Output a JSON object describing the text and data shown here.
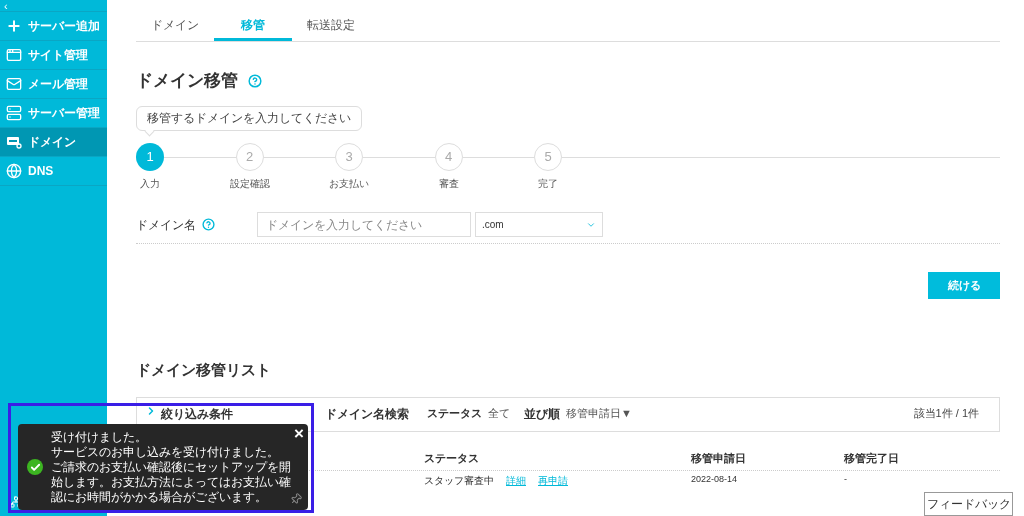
{
  "sidebar": {
    "collapse_label": "‹",
    "items": [
      {
        "kind": "plus",
        "label": "サーバー追加",
        "selected": false
      },
      {
        "kind": "window",
        "label": "サイト管理",
        "selected": false
      },
      {
        "kind": "mail",
        "label": "メール管理",
        "selected": false
      },
      {
        "kind": "server",
        "label": "サーバー管理",
        "selected": false
      },
      {
        "kind": "domain",
        "label": "ドメイン",
        "selected": true
      },
      {
        "kind": "globe",
        "label": "DNS",
        "selected": false
      }
    ]
  },
  "tabs": [
    {
      "label": "ドメイン",
      "selected": false
    },
    {
      "label": "移管",
      "selected": true
    },
    {
      "label": "転送設定",
      "selected": false
    }
  ],
  "title": "ドメイン移管",
  "hint": "移管するドメインを入力してください",
  "steps": [
    {
      "number": "1",
      "label": "入力",
      "selected": true
    },
    {
      "number": "2",
      "label": "設定確認",
      "selected": false
    },
    {
      "number": "3",
      "label": "お支払い",
      "selected": false
    },
    {
      "number": "4",
      "label": "審査",
      "selected": false
    },
    {
      "number": "5",
      "label": "完了",
      "selected": false
    }
  ],
  "form": {
    "label": "ドメイン名",
    "placeholder": "ドメインを入力してください",
    "tld": ".com",
    "submit": "続ける"
  },
  "list": {
    "title": "ドメイン移管リスト",
    "filter": {
      "title": "絞り込み条件",
      "search": "ドメイン名検索",
      "status_label": "ステータス",
      "status_value": "全て",
      "sort_label": "並び順",
      "sort_value": "移管申請日▼",
      "count": "該当1件 / 1件"
    },
    "columns": [
      "ステータス",
      "移管申請日",
      "移管完了日"
    ],
    "rows": [
      {
        "status": "スタッフ審査中",
        "links": [
          "詳細",
          "再申請"
        ],
        "requested": "2022-08-14",
        "completed": "-"
      }
    ]
  },
  "toast": {
    "lines": [
      "受け付けました。",
      "サービスのお申し込みを受け付けました。",
      "ご請求のお支払い確認後にセットアップを開始します。お支払方法によってはお支払い確認にお時間がかかる場合がございます。"
    ],
    "close": "×"
  },
  "feedback": "フィードバック"
}
